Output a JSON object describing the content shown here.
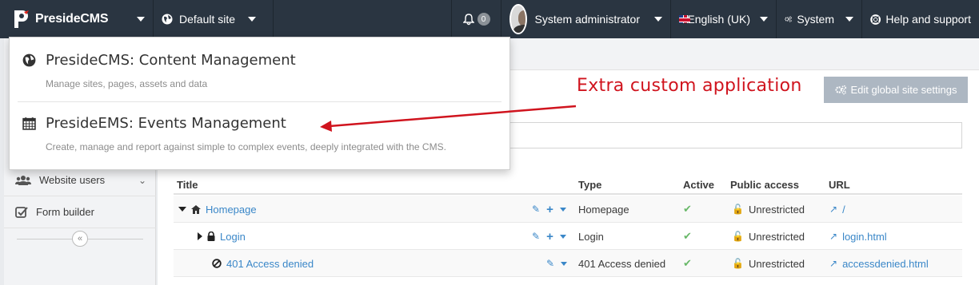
{
  "navbar": {
    "brand": "PresideCMS",
    "site_selector": "Default site",
    "notifications_count": "0",
    "user_name": "System administrator",
    "language": "English (UK)",
    "system": "System",
    "help": "Help and support"
  },
  "app_menu": {
    "items": [
      {
        "title": "PresideCMS: Content Management",
        "description": "Manage sites, pages, assets and data",
        "icon": "globe-icon"
      },
      {
        "title": "PresideEMS: Events Management",
        "description": "Create, manage and report against simple to complex events, deeply integrated with the CMS.",
        "icon": "calendar-icon"
      }
    ]
  },
  "annotation": {
    "text": "Extra custom application",
    "color": "#d0141e"
  },
  "sidebar": {
    "items": [
      {
        "label": "Website users",
        "icon": "users-icon"
      },
      {
        "label": "Form builder",
        "icon": "checkbox-icon"
      }
    ],
    "collapse_symbol": "«"
  },
  "toolbar": {
    "global_settings_label": "Edit global site settings"
  },
  "sitetree": {
    "columns": [
      "Title",
      "Type",
      "Active",
      "Public access",
      "URL"
    ],
    "rows": [
      {
        "title": "Homepage",
        "type": "Homepage",
        "access": "Unrestricted",
        "url": "/"
      },
      {
        "title": "Login",
        "type": "Login",
        "access": "Unrestricted",
        "url": "login.html"
      },
      {
        "title": "401 Access denied",
        "type": "401 Access denied",
        "access": "Unrestricted",
        "url": "accessdenied.html"
      }
    ]
  },
  "colors": {
    "navbar": "#2a3541",
    "link": "#3a87c8",
    "success": "#68b868",
    "button_disabled": "#adb7c2"
  }
}
